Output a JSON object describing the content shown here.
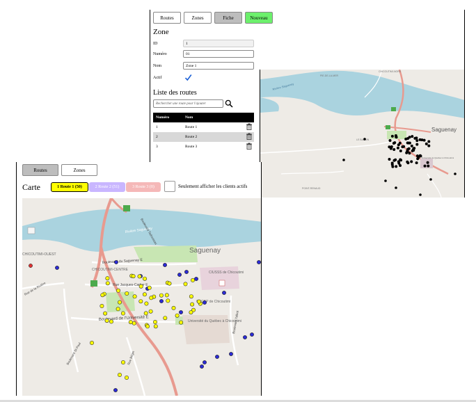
{
  "zone_window": {
    "tabs": [
      {
        "label": "Routes"
      },
      {
        "label": "Zones"
      },
      {
        "label": "Fiche"
      },
      {
        "label": "Nouveau"
      }
    ],
    "title": "Zone",
    "fields": {
      "id_label": "ID",
      "id_value": "1",
      "numero_label": "Numéro",
      "numero_value": "01",
      "nom_label": "Nom",
      "nom_value": "Zone 1",
      "actif_label": "Actif",
      "actif_checked": true
    },
    "routes_heading": "Liste des routes",
    "search_placeholder": "Rechercher une route pour l'ajouter",
    "table": {
      "headers": [
        "Numéro",
        "Nom",
        ""
      ],
      "rows": [
        {
          "numero": "1",
          "nom": "Route 1"
        },
        {
          "numero": "2",
          "nom": "Route 2"
        },
        {
          "numero": "3",
          "nom": "Route 3"
        }
      ]
    },
    "map_labels": {
      "city": "Saguenay",
      "river": "Rivière Saguenay",
      "place1": "PIE-DE-LA-MER",
      "place2": "CHICOUTIMI-NORD",
      "place3": "LE BASSIN",
      "place4": "POINT-RENAUD",
      "univ": "Université du Québec à Chicoutimi"
    }
  },
  "carte_window": {
    "tabs": [
      {
        "label": "Routes"
      },
      {
        "label": "Zones"
      }
    ],
    "title": "Carte",
    "route_buttons": [
      {
        "label": "1 Route 1 (50)",
        "color": "#ffff00"
      },
      {
        "label": "2 Route 2 (51)",
        "color": "#c9b6ff"
      },
      {
        "label": "3 Route 3 (0)",
        "color": "#f5b8b8"
      }
    ],
    "active_only_label": "Seulement afficher les clients actifs",
    "map_labels": {
      "city": "Saguenay",
      "river": "Rivière Saguenay",
      "quartier": "CHICOUTIMI-OUEST",
      "centre": "CHICOUTIMI-CENTRE",
      "street1": "Boulevard du Saguenay E",
      "street2": "Rue Jacques-Cartier E",
      "street3": "Boulevard de l'Université E",
      "street4": "Boulevard St-Paul",
      "street5": "Rue Bégin",
      "street6": "Boulevard Talbot",
      "street7": "Boulevard Tadoussac",
      "street8": "Rue de la Rivière",
      "ciusss": "CIUSSS de Chicoutimi",
      "cegep": "CEGEP de Chicoutimi",
      "uqac": "Université du Québec à Chicoutimi"
    }
  },
  "colors": {
    "water": "#aad3df",
    "route_yellow": "#ffff00",
    "route_blue": "#2b2bd6",
    "tab_gray": "#bdbdbd",
    "tab_green": "#6cf06c",
    "highway": "#e89a8f",
    "park": "#c8e6b3"
  }
}
